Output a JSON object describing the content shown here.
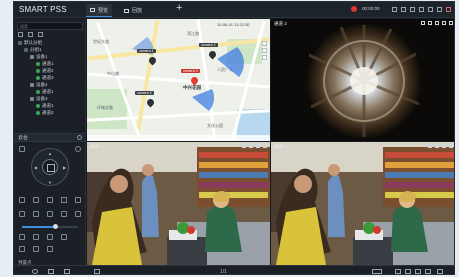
{
  "app": {
    "logo_text": "SMART PSS",
    "tabs": [
      {
        "label": "预览",
        "active": true
      },
      {
        "label": "回放",
        "active": false
      }
    ],
    "add_tab_symbol": "+",
    "clock": "00:00:00"
  },
  "sidebar": {
    "search_placeholder": "搜索",
    "tree": [
      {
        "label": "默认分组",
        "level": 0,
        "kind": "group"
      },
      {
        "label": "分组1",
        "level": 1,
        "kind": "group"
      },
      {
        "label": "设备1",
        "level": 2,
        "kind": "dev"
      },
      {
        "label": "通道1",
        "level": 3,
        "kind": "cam"
      },
      {
        "label": "通道2",
        "level": 3,
        "kind": "cam"
      },
      {
        "label": "通道3",
        "level": 3,
        "kind": "cam"
      },
      {
        "label": "设备2",
        "level": 2,
        "kind": "dev"
      },
      {
        "label": "通道1",
        "level": 3,
        "kind": "cam"
      },
      {
        "label": "设备3",
        "level": 2,
        "kind": "dev"
      },
      {
        "label": "通道1",
        "level": 3,
        "kind": "cam"
      },
      {
        "label": "通道2",
        "level": 3,
        "kind": "cam"
      }
    ],
    "ptz_title": "云台",
    "preset_title": "预置点",
    "speed": 0.6
  },
  "map": {
    "timestamp": "10-06-01 11:22:30",
    "labels": [
      "世纪大道",
      "滨江路",
      "中山路",
      "人民广场",
      "中兴花园",
      "环城北路",
      "文化公园"
    ],
    "highlight": "中兴花园",
    "tags": [
      "camera 1",
      "camera 2",
      "camera 3",
      "camera 4"
    ]
  },
  "views": {
    "map_label": "",
    "fisheye_label": "通道 2",
    "cam3_label": "通道 3",
    "cam4_label": "通道 4"
  },
  "bottom": {
    "page_indicator": "1/1"
  }
}
